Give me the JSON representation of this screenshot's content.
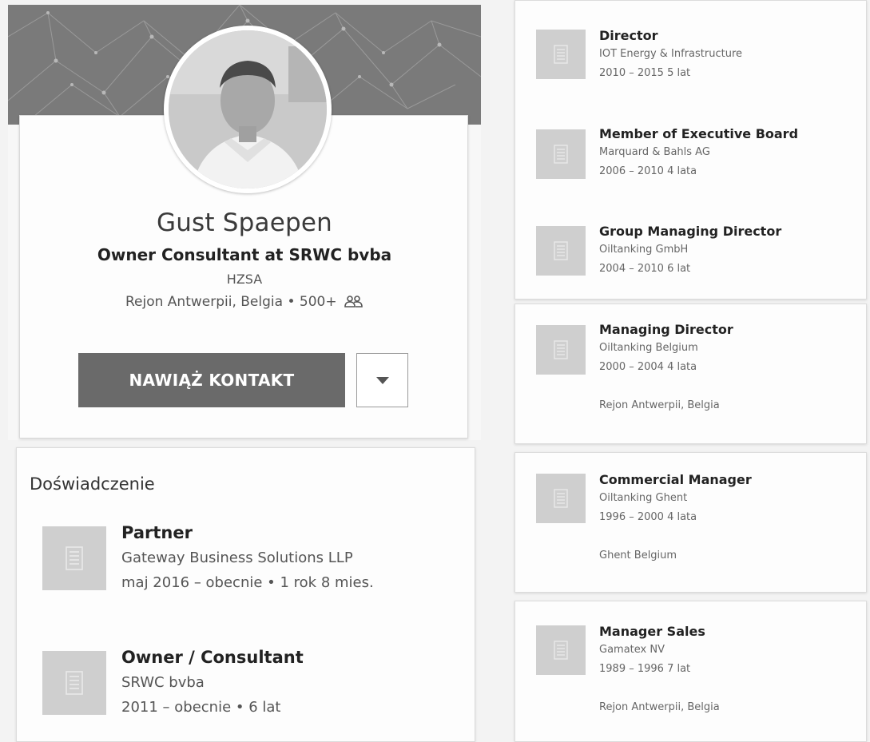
{
  "profile": {
    "name": "Gust Spaepen",
    "headline": "Owner Consultant at SRWC bvba",
    "school": "HZSA",
    "location": "Rejon Antwerpii, Belgia",
    "connections": "500+",
    "connect_label": "NAWIĄŻ KONTAKT"
  },
  "experience": {
    "title": "Doświadczenie",
    "items": [
      {
        "role": "Partner",
        "company": "Gateway Business Solutions LLP",
        "dates": "maj 2016 – obecnie • 1 rok 8 mies."
      },
      {
        "role": "Owner / Consultant",
        "company": "SRWC bvba",
        "dates": "2011 – obecnie • 6 lat"
      }
    ]
  },
  "right_experience": [
    {
      "role": "Director",
      "company": "IOT Energy & Infrastructure",
      "dates": "2010 – 2015 5 lat",
      "location": ""
    },
    {
      "role": "Member of Executive Board",
      "company": "Marquard & Bahls AG",
      "dates": "2006 – 2010 4 lata",
      "location": ""
    },
    {
      "role": "Group Managing Director",
      "company": "Oiltanking GmbH",
      "dates": "2004 – 2010 6 lat",
      "location": ""
    },
    {
      "role": "Managing Director",
      "company": "Oiltanking Belgium",
      "dates": "2000 – 2004 4 lata",
      "location": "Rejon Antwerpii, Belgia"
    },
    {
      "role": "Commercial Manager",
      "company": "Oiltanking Ghent",
      "dates": "1996 – 2000 4 lata",
      "location": "Ghent Belgium"
    },
    {
      "role": "Manager Sales",
      "company": "Gamatex NV",
      "dates": "1989 – 1996 7 lat",
      "location": "Rejon Antwerpii, Belgia"
    }
  ]
}
